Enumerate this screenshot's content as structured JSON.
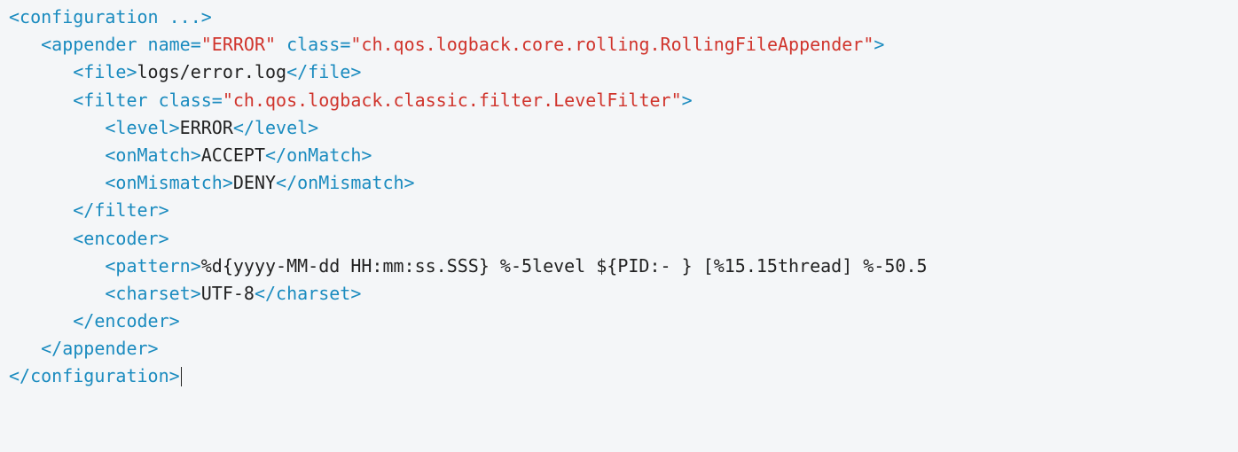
{
  "code": {
    "ind1": "   ",
    "ind2": "      ",
    "ind3": "         ",
    "line1": {
      "open": "<configuration ...>"
    },
    "line2": {
      "open": "<appender",
      "attr1_name": " name",
      "eq": "=",
      "attr1_val": "\"ERROR\"",
      "attr2_name": " class",
      "attr2_val": "\"ch.qos.logback.core.rolling.RollingFileAppender\"",
      "close": ">"
    },
    "line3": {
      "open": "<file>",
      "text": "logs/error.log",
      "close": "</file>"
    },
    "line4": {
      "open": "<filter",
      "attr_name": " class",
      "eq": "=",
      "attr_val": "\"ch.qos.logback.classic.filter.LevelFilter\"",
      "close": ">"
    },
    "line5": {
      "open": "<level>",
      "text": "ERROR",
      "close": "</level>"
    },
    "line6": {
      "open": "<onMatch>",
      "text": "ACCEPT",
      "close": "</onMatch>"
    },
    "line7": {
      "open": "<onMismatch>",
      "text": "DENY",
      "close": "</onMismatch>"
    },
    "line8": {
      "close": "</filter>"
    },
    "line9": {
      "open": "<encoder>"
    },
    "line10": {
      "open": "<pattern>",
      "text": "%d{yyyy-MM-dd HH:mm:ss.SSS} %-5level ${PID:- } [%15.15thread] %-50.5"
    },
    "line11": {
      "open": "<charset>",
      "text": "UTF-8",
      "close": "</charset>"
    },
    "line12": {
      "close": "</encoder>"
    },
    "line13": {
      "close": "</appender>"
    },
    "line14": {
      "close": "</configuration>"
    }
  }
}
